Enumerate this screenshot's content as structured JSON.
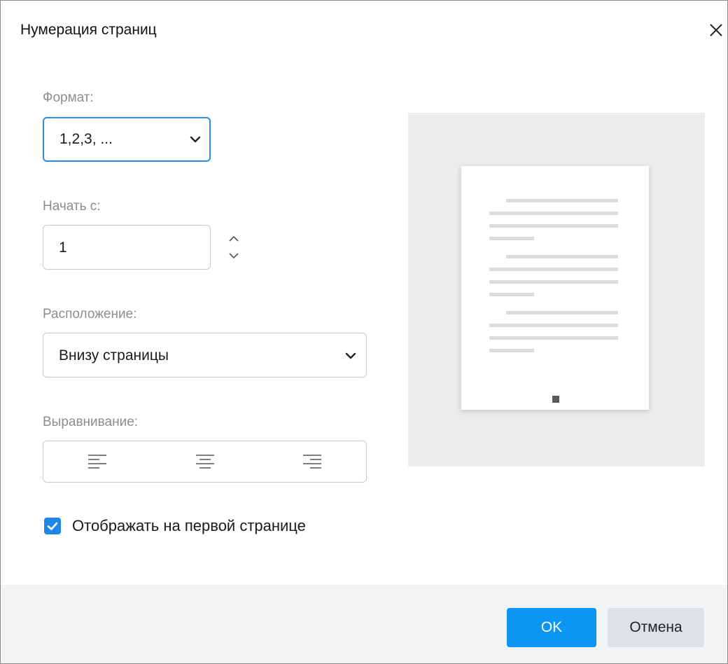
{
  "dialog": {
    "title": "Нумерация страниц",
    "close_icon": "close-icon"
  },
  "format": {
    "label": "Формат:",
    "selected": "1,2,3, ..."
  },
  "start": {
    "label": "Начать с:",
    "value": "1"
  },
  "position": {
    "label": "Расположение:",
    "selected": "Внизу страницы"
  },
  "alignment": {
    "label": "Выравнивание:",
    "options": [
      "align-left-icon",
      "align-center-icon",
      "align-right-icon"
    ]
  },
  "show_first": {
    "label": "Отображать на первой странице",
    "checked": true
  },
  "buttons": {
    "ok": "OK",
    "cancel": "Отмена"
  },
  "colors": {
    "accent": "#0a96f2",
    "checkbox": "#1f87e5",
    "focus_border": "#2d8be6"
  }
}
